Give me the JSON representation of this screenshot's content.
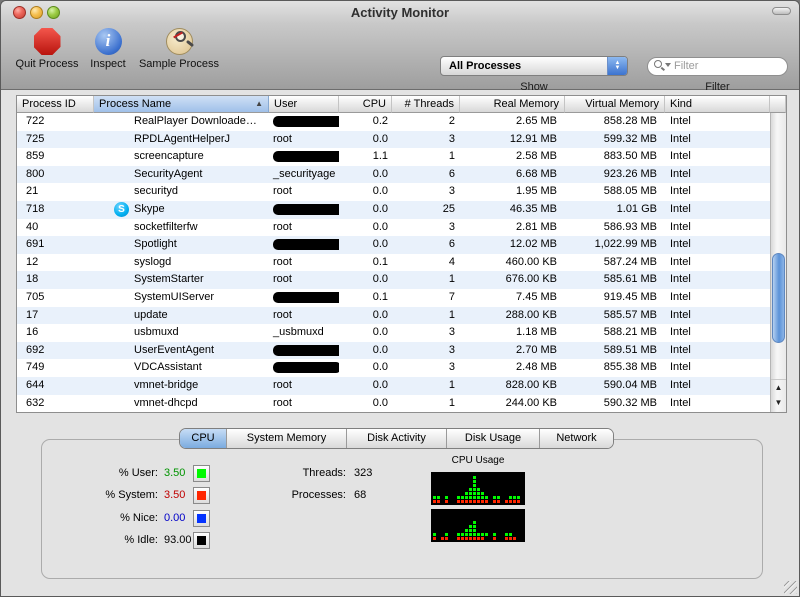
{
  "window": {
    "title": "Activity Monitor"
  },
  "toolbar": {
    "buttons": [
      {
        "label": "Quit Process",
        "icon": "stop-octagon-icon"
      },
      {
        "label": "Inspect",
        "icon": "info-circle-icon"
      },
      {
        "label": "Sample Process",
        "icon": "sample-magnifier-icon"
      }
    ],
    "show": {
      "label": "Show",
      "selected": "All Processes"
    },
    "filter": {
      "label": "Filter",
      "placeholder": "Filter"
    }
  },
  "table": {
    "columns": [
      {
        "label": "Process ID",
        "align": "left"
      },
      {
        "label": "Process Name",
        "align": "left",
        "sorted": "asc"
      },
      {
        "label": "User",
        "align": "left"
      },
      {
        "label": "CPU",
        "align": "right"
      },
      {
        "label": "# Threads",
        "align": "right"
      },
      {
        "label": "Real Memory",
        "align": "right"
      },
      {
        "label": "Virtual Memory",
        "align": "right"
      },
      {
        "label": "Kind",
        "align": "left"
      }
    ],
    "rows": [
      {
        "pid": "722",
        "name": "RealPlayer Downloade…",
        "user": "",
        "redacted": true,
        "redact_w": 78,
        "cpu": "0.2",
        "threads": "2",
        "real": "2.65 MB",
        "virtual": "858.28 MB",
        "kind": "Intel"
      },
      {
        "pid": "725",
        "name": "RPDLAgentHelperJ",
        "user": "root",
        "cpu": "0.0",
        "threads": "3",
        "real": "12.91 MB",
        "virtual": "599.32 MB",
        "kind": "Intel"
      },
      {
        "pid": "859",
        "name": "screencapture",
        "user": "",
        "redacted": true,
        "redact_w": 96,
        "cpu": "1.1",
        "threads": "1",
        "real": "2.58 MB",
        "virtual": "883.50 MB",
        "kind": "Intel"
      },
      {
        "pid": "800",
        "name": "SecurityAgent",
        "user": "_securityage",
        "cpu": "0.0",
        "threads": "6",
        "real": "6.68 MB",
        "virtual": "923.26 MB",
        "kind": "Intel"
      },
      {
        "pid": "21",
        "name": "securityd",
        "user": "root",
        "cpu": "0.0",
        "threads": "3",
        "real": "1.95 MB",
        "virtual": "588.05 MB",
        "kind": "Intel"
      },
      {
        "pid": "718",
        "name": "Skype",
        "icon": "skype",
        "user": "",
        "redacted": true,
        "redact_w": 82,
        "cpu": "0.0",
        "threads": "25",
        "real": "46.35 MB",
        "virtual": "1.01 GB",
        "kind": "Intel"
      },
      {
        "pid": "40",
        "name": "socketfilterfw",
        "user": "root",
        "cpu": "0.0",
        "threads": "3",
        "real": "2.81 MB",
        "virtual": "586.93 MB",
        "kind": "Intel"
      },
      {
        "pid": "691",
        "name": "Spotlight",
        "user": "",
        "redacted": true,
        "redact_w": 74,
        "cpu": "0.0",
        "threads": "6",
        "real": "12.02 MB",
        "virtual": "1,022.99 MB",
        "kind": "Intel"
      },
      {
        "pid": "12",
        "name": "syslogd",
        "user": "root",
        "cpu": "0.1",
        "threads": "4",
        "real": "460.00 KB",
        "virtual": "587.24 MB",
        "kind": "Intel"
      },
      {
        "pid": "18",
        "name": "SystemStarter",
        "user": "root",
        "cpu": "0.0",
        "threads": "1",
        "real": "676.00 KB",
        "virtual": "585.61 MB",
        "kind": "Intel"
      },
      {
        "pid": "705",
        "name": "SystemUIServer",
        "user": "",
        "redacted": true,
        "redact_w": 80,
        "cpu": "0.1",
        "threads": "7",
        "real": "7.45 MB",
        "virtual": "919.45 MB",
        "kind": "Intel"
      },
      {
        "pid": "17",
        "name": "update",
        "user": "root",
        "cpu": "0.0",
        "threads": "1",
        "real": "288.00 KB",
        "virtual": "585.57 MB",
        "kind": "Intel"
      },
      {
        "pid": "16",
        "name": "usbmuxd",
        "user": "_usbmuxd",
        "cpu": "0.0",
        "threads": "3",
        "real": "1.18 MB",
        "virtual": "588.21 MB",
        "kind": "Intel"
      },
      {
        "pid": "692",
        "name": "UserEventAgent",
        "user": "",
        "redacted": true,
        "redact_w": 72,
        "cpu": "0.0",
        "threads": "3",
        "real": "2.70 MB",
        "virtual": "589.51 MB",
        "kind": "Intel"
      },
      {
        "pid": "749",
        "name": "VDCAssistant",
        "user": "",
        "redacted": true,
        "redact_w": 68,
        "cpu": "0.0",
        "threads": "3",
        "real": "2.48 MB",
        "virtual": "855.38 MB",
        "kind": "Intel"
      },
      {
        "pid": "644",
        "name": "vmnet-bridge",
        "user": "root",
        "cpu": "0.0",
        "threads": "1",
        "real": "828.00 KB",
        "virtual": "590.04 MB",
        "kind": "Intel"
      },
      {
        "pid": "632",
        "name": "vmnet-dhcpd",
        "user": "root",
        "cpu": "0.0",
        "threads": "1",
        "real": "244.00 KB",
        "virtual": "590.32 MB",
        "kind": "Intel"
      }
    ]
  },
  "tabs": {
    "items": [
      "CPU",
      "System Memory",
      "Disk Activity",
      "Disk Usage",
      "Network"
    ],
    "selected": "CPU"
  },
  "cpu_panel": {
    "stats": [
      {
        "label": "% User:",
        "value": "3.50",
        "value_color": "#009400",
        "swatch_color": "#00f900"
      },
      {
        "label": "% System:",
        "value": "3.50",
        "value_color": "#c00000",
        "swatch_color": "#ff2600"
      },
      {
        "label": "% Nice:",
        "value": "0.00",
        "value_color": "#0000c8",
        "swatch_color": "#0433ff"
      },
      {
        "label": "% Idle:",
        "value": "93.00",
        "value_color": "#000000",
        "swatch_color": "#000000"
      }
    ],
    "threads_label": "Threads:",
    "threads_value": "323",
    "processes_label": "Processes:",
    "processes_value": "68",
    "graph_title": "CPU Usage"
  },
  "chart_data": {
    "type": "bar",
    "title": "CPU Usage",
    "description": "Two stacked LED-style CPU history meters; green = user cpu blocks above baseline, red = system cpu blocks on baseline; 22 time columns each",
    "colors": {
      "user": "#00f900",
      "system": "#ff2600",
      "background": "#000000"
    },
    "panels": [
      {
        "green_heights": [
          1,
          1,
          0,
          1,
          0,
          0,
          1,
          1,
          2,
          3,
          6,
          3,
          2,
          1,
          0,
          1,
          1,
          0,
          0,
          1,
          1,
          1
        ],
        "red_heights": [
          1,
          1,
          0,
          1,
          0,
          0,
          1,
          1,
          1,
          1,
          1,
          1,
          1,
          1,
          0,
          1,
          1,
          0,
          1,
          1,
          1,
          1
        ]
      },
      {
        "green_heights": [
          1,
          0,
          0,
          1,
          0,
          0,
          1,
          1,
          2,
          3,
          4,
          1,
          1,
          1,
          0,
          1,
          0,
          0,
          1,
          1,
          0,
          0
        ],
        "red_heights": [
          1,
          0,
          1,
          1,
          0,
          0,
          1,
          1,
          1,
          1,
          1,
          1,
          1,
          0,
          0,
          1,
          0,
          0,
          1,
          1,
          1,
          0
        ]
      }
    ]
  }
}
